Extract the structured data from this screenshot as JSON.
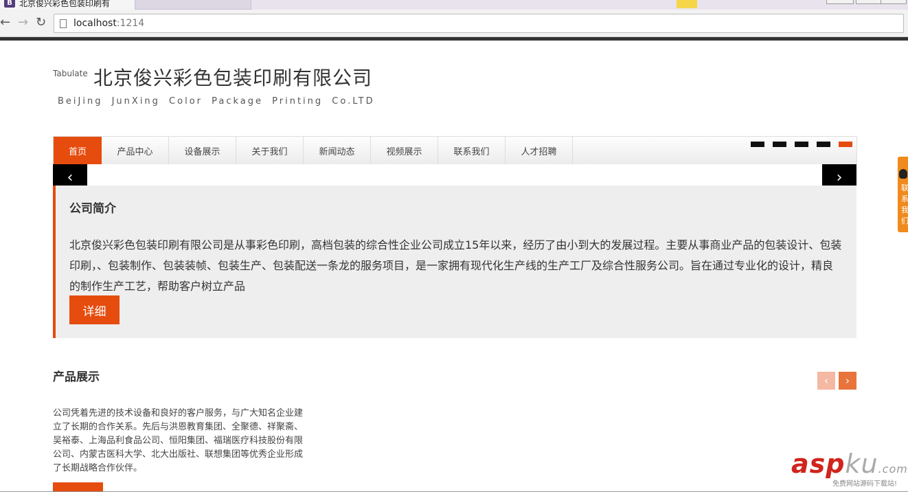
{
  "browser": {
    "tab_title": "北京俊兴彩色包装印刷有",
    "favicon_letter": "B",
    "url_host": "localhost",
    "url_port": ":1214"
  },
  "header": {
    "tagline": "Tabulate",
    "company_name": "北京俊兴彩色包装印刷有限公司",
    "company_name_en": "BeiJing JunXing Color Package Printing Co.LTD"
  },
  "nav": {
    "items": [
      {
        "label": "首页",
        "active": true
      },
      {
        "label": "产品中心",
        "active": false
      },
      {
        "label": "设备展示",
        "active": false
      },
      {
        "label": "关于我们",
        "active": false
      },
      {
        "label": "新闻动态",
        "active": false
      },
      {
        "label": "视频展示",
        "active": false
      },
      {
        "label": "联系我们",
        "active": false
      },
      {
        "label": "人才招聘",
        "active": false
      }
    ],
    "slide_count": 5,
    "active_slide": 4
  },
  "intro": {
    "heading": "公司简介",
    "text": "北京俊兴彩色包装印刷有限公司是从事彩色印刷，高档包装的综合性企业公司成立15年以来，经历了由小到大的发展过程。主要从事商业产品的包装设计、包装印刷，、包装制作、包装装帧、包装生产、包装配送一条龙的服务项目，是一家拥有现代化生产线的生产工厂及综合性服务公司。旨在通过专业化的设计，精良的制作生产工艺，帮助客户树立产品",
    "detail_label": "详细",
    "prev_symbol": "‹",
    "next_symbol": "›"
  },
  "products": {
    "heading": "产品展示",
    "text": "公司凭着先进的技术设备和良好的客户服务，与广大知名企业建立了长期的合作关系。先后与洪恩教育集团、全聚德、祥聚斋、吴裕泰、上海品利食品公司、恒阳集团、福瑞医疗科技股份有限公司、内蒙古医科大学、北大出版社、联想集团等优秀企业形成了长期战略合作伙伴。",
    "prev_symbol": "‹",
    "next_symbol": "›"
  },
  "float_contact": {
    "text": "联系我们"
  },
  "watermark": {
    "asp": "asp",
    "ku": "ku",
    "com": ".com",
    "sub": "免费网站源码下载站!"
  },
  "colors": {
    "accent": "#e64c0e",
    "intro_bg": "#eeeeee"
  }
}
